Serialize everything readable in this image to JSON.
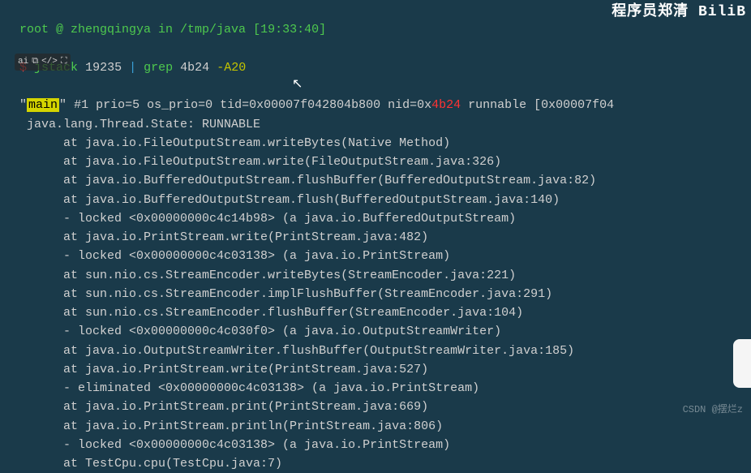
{
  "top_cutoff": "root @ zhengqingya in /tmp/java [19:33:40]",
  "prompt_symbol": "$",
  "command": {
    "cmd": "jstack",
    "pid": "19235",
    "pipe": "|",
    "grep": "grep",
    "pattern": "4b24",
    "flag": "-A20"
  },
  "thread_header": {
    "quote1": "\"",
    "main": "main",
    "quote2": "\"",
    "rest1": " #1 prio=5 os_prio=0 tid=0x00007f042804b800 nid=0x",
    "match": "4b24",
    "rest2": " runnable [0x00007f04"
  },
  "state_line": "   java.lang.Thread.State: RUNNABLE",
  "stack": [
    "        at java.io.FileOutputStream.writeBytes(Native Method)",
    "        at java.io.FileOutputStream.write(FileOutputStream.java:326)",
    "        at java.io.BufferedOutputStream.flushBuffer(BufferedOutputStream.java:82)",
    "        at java.io.BufferedOutputStream.flush(BufferedOutputStream.java:140)",
    "        - locked <0x00000000c4c14b98> (a java.io.BufferedOutputStream)",
    "        at java.io.PrintStream.write(PrintStream.java:482)",
    "        - locked <0x00000000c4c03138> (a java.io.PrintStream)",
    "        at sun.nio.cs.StreamEncoder.writeBytes(StreamEncoder.java:221)",
    "        at sun.nio.cs.StreamEncoder.implFlushBuffer(StreamEncoder.java:291)",
    "        at sun.nio.cs.StreamEncoder.flushBuffer(StreamEncoder.java:104)",
    "        - locked <0x00000000c4c030f0> (a java.io.OutputStreamWriter)",
    "        at java.io.OutputStreamWriter.flushBuffer(OutputStreamWriter.java:185)",
    "        at java.io.PrintStream.write(PrintStream.java:527)",
    "        - eliminated <0x00000000c4c03138> (a java.io.PrintStream)",
    "        at java.io.PrintStream.print(PrintStream.java:669)",
    "        at java.io.PrintStream.println(PrintStream.java:806)",
    "        - locked <0x00000000c4c03138> (a java.io.PrintStream)",
    "        at TestCpu.cpu(TestCpu.java:7)"
  ],
  "top_right": "程序员郑清  BiliB",
  "watermark": "CSDN @摆烂z",
  "toolbar_icons": [
    "ai",
    "copy",
    "code",
    "expand"
  ]
}
